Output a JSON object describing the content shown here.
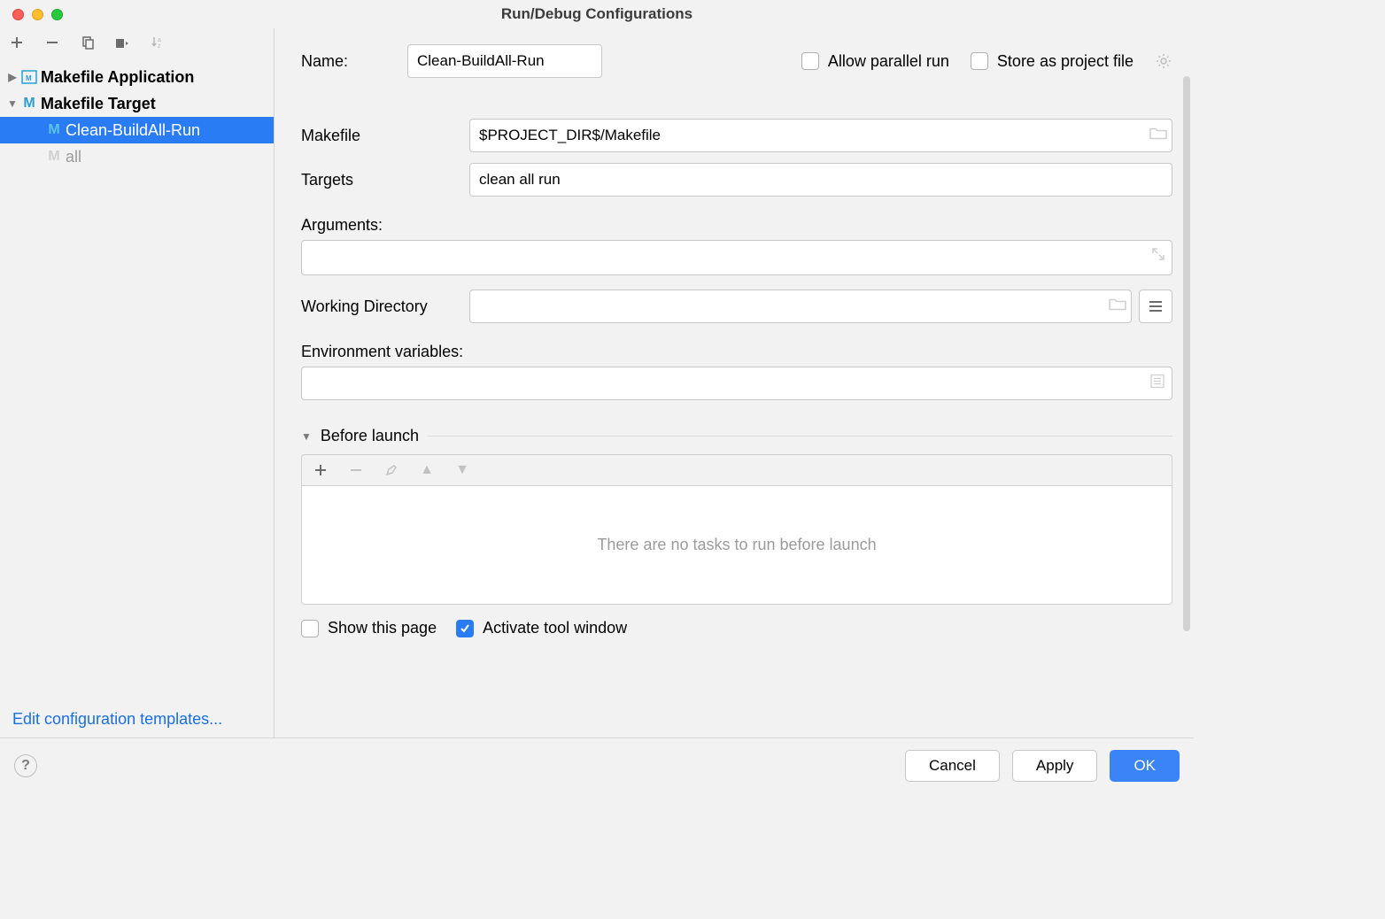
{
  "window": {
    "title": "Run/Debug Configurations"
  },
  "toolbar_icons": {
    "add": "+",
    "remove": "−",
    "copy": "copy",
    "save": "save",
    "sort": "↓az"
  },
  "tree": {
    "makefile_application": "Makefile Application",
    "makefile_target": "Makefile Target",
    "children": [
      {
        "label": "Clean-BuildAll-Run",
        "selected": true
      },
      {
        "label": "all",
        "dim": true
      }
    ]
  },
  "left_footer_link": "Edit configuration templates...",
  "form": {
    "name_label": "Name:",
    "name_value": "Clean-BuildAll-Run",
    "allow_parallel_label": "Allow parallel run",
    "store_project_label": "Store as project file",
    "makefile_label": "Makefile",
    "makefile_value": "$PROJECT_DIR$/Makefile",
    "targets_label": "Targets",
    "targets_value": "clean all run",
    "arguments_label": "Arguments:",
    "arguments_value": "",
    "workdir_label": "Working Directory",
    "workdir_value": "",
    "env_label": "Environment variables:",
    "env_value": "",
    "before_launch_label": "Before launch",
    "before_launch_empty": "There are no tasks to run before launch",
    "show_this_page_label": "Show this page",
    "activate_tool_window_label": "Activate tool window"
  },
  "footer": {
    "cancel": "Cancel",
    "apply": "Apply",
    "ok": "OK"
  }
}
